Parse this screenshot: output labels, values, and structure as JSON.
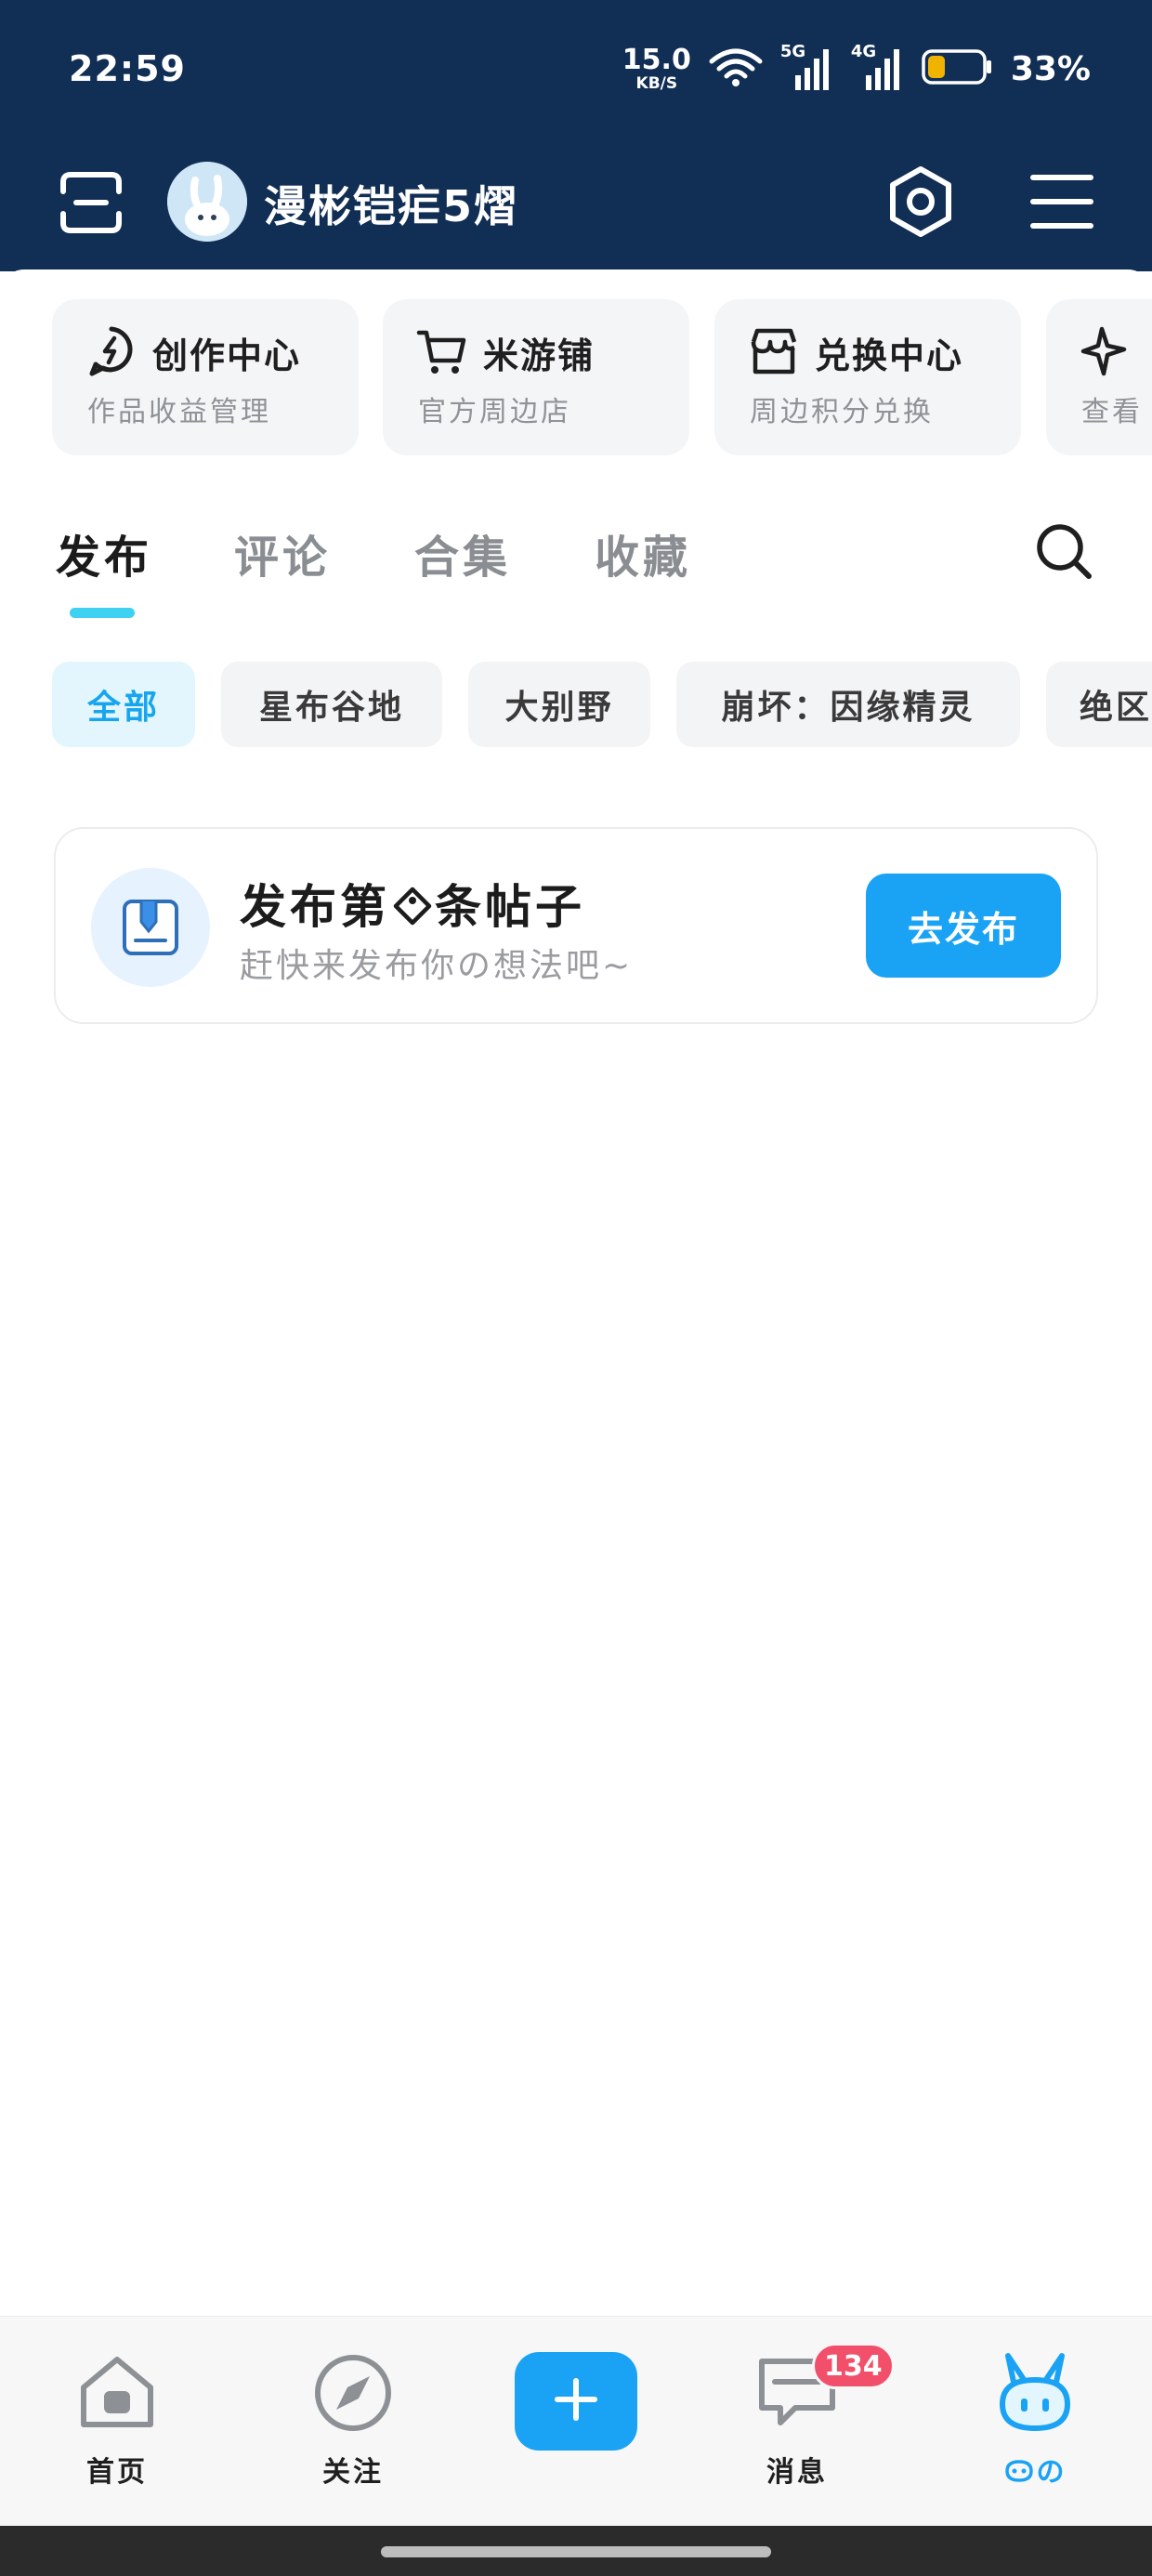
{
  "status_bar": {
    "time": "22:59",
    "net_speed_value": "15.0",
    "net_speed_unit": "KB/S",
    "signal_1": "5G",
    "signal_2": "4G",
    "battery_percent": "33%",
    "battery_level": 0.33,
    "battery_color": "#f0b400"
  },
  "header": {
    "username": "漫彬铠疟5熠",
    "background": "#112e55"
  },
  "quick_links": [
    {
      "title": "创作中心",
      "subtitle": "作品收益管理",
      "icon": "lightning-bulb-icon"
    },
    {
      "title": "米游铺",
      "subtitle": "官方周边店",
      "icon": "cart-icon"
    },
    {
      "title": "兑换中心",
      "subtitle": "周边积分兑换",
      "icon": "shop-icon"
    },
    {
      "title": "",
      "subtitle": "查看",
      "icon": "sparkle-icon"
    }
  ],
  "tabs": [
    {
      "label": "发布",
      "active": true
    },
    {
      "label": "评论",
      "active": false
    },
    {
      "label": "合集",
      "active": false
    },
    {
      "label": "收藏",
      "active": false
    }
  ],
  "chips": [
    {
      "label": "全部",
      "active": true
    },
    {
      "label": "星布谷地",
      "active": false
    },
    {
      "label": "大别野",
      "active": false
    },
    {
      "label": "崩坏：因缘精灵",
      "active": false
    },
    {
      "label": "绝区",
      "active": false
    }
  ],
  "post_prompt": {
    "title": "发布第",
    "title_icon": "tag-icon",
    "title_suffix": "条帖子",
    "subtitle": "赶快来发布你の想法吧~",
    "button": "去发布"
  },
  "bottom_nav": [
    {
      "label": "首页",
      "icon": "home-icon",
      "active": false
    },
    {
      "label": "关注",
      "icon": "compass-icon",
      "active": false
    },
    {
      "label": "",
      "icon": "plus-icon",
      "active": false
    },
    {
      "label": "消息",
      "icon": "chat-icon",
      "active": false,
      "badge": "134"
    },
    {
      "label": "の",
      "icon": "bunny-icon",
      "active": true
    }
  ],
  "colors": {
    "accent": "#1aa3f4",
    "tab_indicator": "#3fd1f1",
    "badge": "#f2506a"
  }
}
